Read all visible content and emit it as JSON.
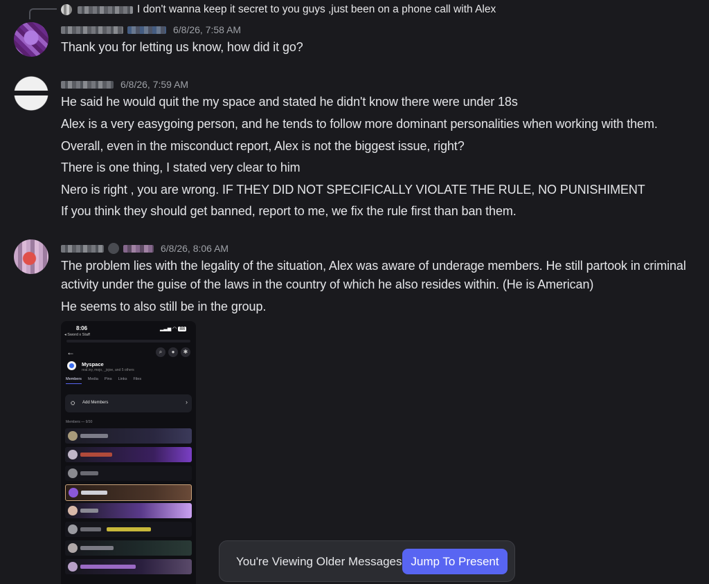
{
  "reply": {
    "text": "I don't wanna keep it secret to you guys ,just been on a phone call with Alex"
  },
  "messages": [
    {
      "timestamp": "6/8/26, 7:58 AM",
      "lines": [
        "Thank you for letting us know, how did it go?"
      ]
    },
    {
      "timestamp": "6/8/26, 7:59 AM",
      "lines": [
        "He said he would quit the my space and stated he didn't know there were under 18s",
        "Alex is a very easygoing person, and he tends to follow more dominant personalities when working with them.",
        "Overall, even in the misconduct report, Alex is not the biggest issue, right?",
        "There is one thing, I stated very clear to him",
        "Nero is right , you are wrong. IF THEY DID NOT SPECIFICALLY VIOLATE THE RULE, NO PUNISHIMENT",
        "If you think they should get banned, report to me, we fix the rule first than ban them."
      ]
    },
    {
      "timestamp": "6/8/26, 8:06 AM",
      "lines": [
        "The problem lies with the legality of the situation, Alex was aware of underage members. He still partook in criminal activity under the guise of the laws in the country of which he also resides within. (He is American)",
        "He seems to also still be in the group."
      ]
    }
  ],
  "attachment": {
    "time": "8:06",
    "back_label": "◂ Sword x Staff",
    "battery": "88",
    "group_name": "Myspace",
    "group_members": "real.ivy, mojo, _jojoe, and 5 others",
    "tabs": [
      "Members",
      "Media",
      "Pins",
      "Links",
      "Files"
    ],
    "add_members": "Add Members",
    "members_header": "Members — 9/30"
  },
  "banner": {
    "text": "You're Viewing Older Messages",
    "button": "Jump To Present"
  },
  "colors": {
    "background": "#1a1a1e",
    "accent": "#5865f2",
    "timestamp": "#9ea1a7"
  }
}
